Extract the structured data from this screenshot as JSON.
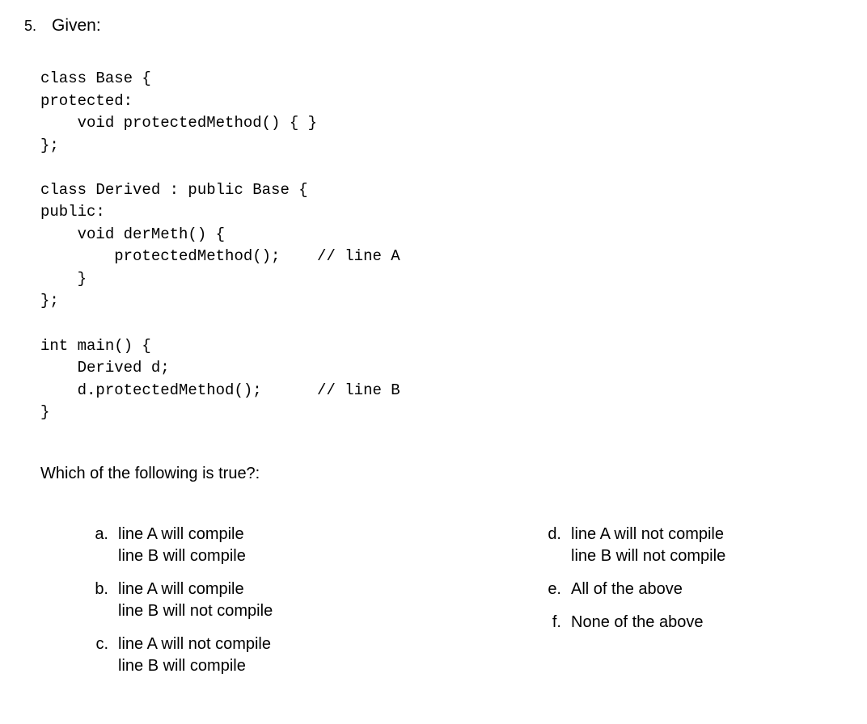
{
  "question": {
    "number": "5.",
    "title": "Given:"
  },
  "code": "class Base {\nprotected:\n    void protectedMethod() { }\n};\n\nclass Derived : public Base {\npublic:\n    void derMeth() {\n        protectedMethod();    // line A\n    }\n};\n\nint main() {\n    Derived d;\n    d.protectedMethod();      // line B\n}",
  "prompt": "Which of the following is true?:",
  "options_left": [
    {
      "marker": "a.",
      "text": "line A will compile\nline B will compile"
    },
    {
      "marker": "b.",
      "text": "line A will compile\nline B will not compile"
    },
    {
      "marker": "c.",
      "text": "line A will not compile\nline B will compile"
    }
  ],
  "options_right": [
    {
      "marker": "d.",
      "text": "line A will not compile\nline B will not compile"
    },
    {
      "marker": "e.",
      "text": "All of the above"
    },
    {
      "marker": "f.",
      "text": "None of the above"
    }
  ]
}
